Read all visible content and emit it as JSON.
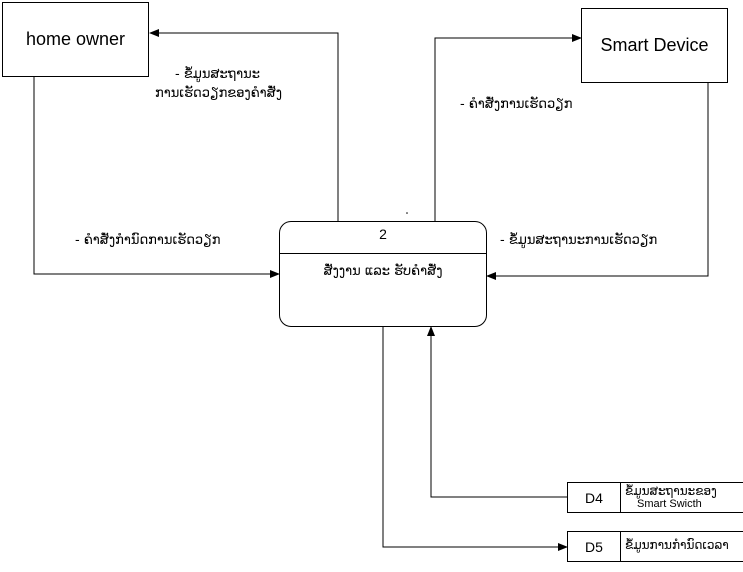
{
  "entities": {
    "home_owner": "home  owner",
    "smart_device": "Smart  Device"
  },
  "process": {
    "id": "2",
    "name": "ສັ່ງງານ  ແລະ  ຮັບຄຳສັ່ງ"
  },
  "data_stores": {
    "d4": {
      "id": "D4",
      "name_line1": "ຂໍ້ມູນສະຖານະຂອງ",
      "name_line2": "Smart  Swicth"
    },
    "d5": {
      "id": "D5",
      "name": "ຂໍ້ມູນການກຳນົດເວລາ"
    }
  },
  "flows": {
    "process_to_homeowner_1": "-  ຂໍ້ມູນສະຖານະ",
    "process_to_homeowner_2": "ການເຮັດວຽກຂອງຄຳສັ່ງ",
    "homeowner_to_process": "-  ຄຳສັ່ງກຳນົດການເຮັດວຽກ",
    "process_to_device": "-    ຄຳສັ່ງການເຮັດວຽກ",
    "device_to_process": "-  ຂໍ້ມູນສະຖານະການເຮັດວຽກ"
  }
}
